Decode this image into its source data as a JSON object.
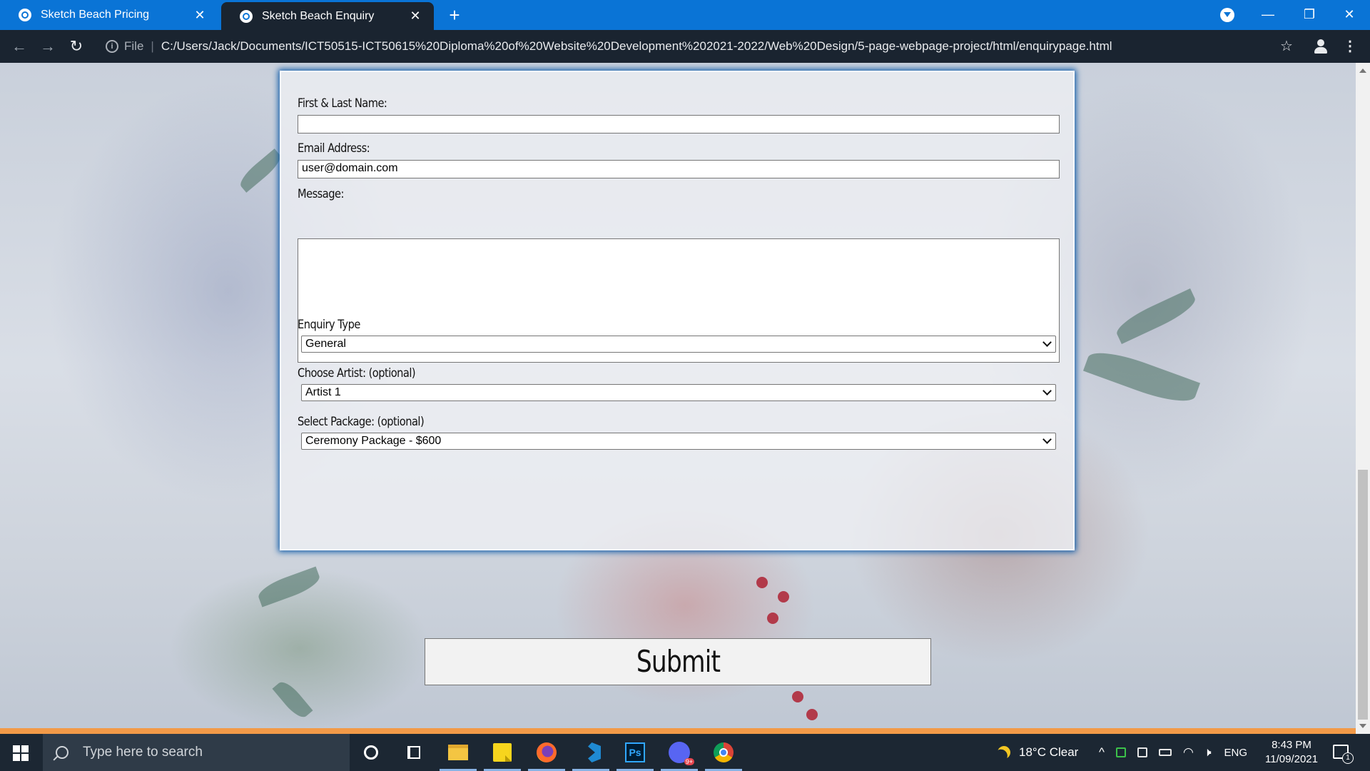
{
  "browser": {
    "tabs": [
      {
        "title": "Sketch Beach Pricing",
        "active": false
      },
      {
        "title": "Sketch Beach Enquiry",
        "active": true
      }
    ],
    "address": {
      "scheme_label": "File",
      "url": "C:/Users/Jack/Documents/ICT50515-ICT50615%20Diploma%20of%20Website%20Development%202021-2022/Web%20Design/5-page-webpage-project/html/enquirypage.html"
    }
  },
  "form": {
    "name_label": "First & Last Name:",
    "name_value": "",
    "email_label": "Email Address:",
    "email_value": "user@domain.com",
    "message_label": "Message:",
    "message_value": "",
    "enquiry_label": "Enquiry Type",
    "enquiry_selected": "General",
    "artist_label": "Choose Artist: (optional)",
    "artist_selected": "Artist 1",
    "package_label": "Select Package: (optional)",
    "package_selected": "Ceremony Package - $600",
    "submit_label": "Submit"
  },
  "taskbar": {
    "search_placeholder": "Type here to search",
    "weather": "18°C  Clear",
    "language": "ENG",
    "time": "8:43 PM",
    "date": "11/09/2021",
    "notification_count": "1",
    "apps": [
      "cortana-icon",
      "task-view-icon",
      "file-explorer-icon",
      "sticky-notes-icon",
      "firefox-icon",
      "vscode-icon",
      "photoshop-icon",
      "discord-icon",
      "chrome-icon"
    ]
  },
  "colors": {
    "tabbar": "#0a74d6",
    "toolbar": "#1a2430",
    "panel_glow": "#0d5aa8",
    "accent_strip": "#f29a48",
    "taskbar": "#1c2733"
  }
}
